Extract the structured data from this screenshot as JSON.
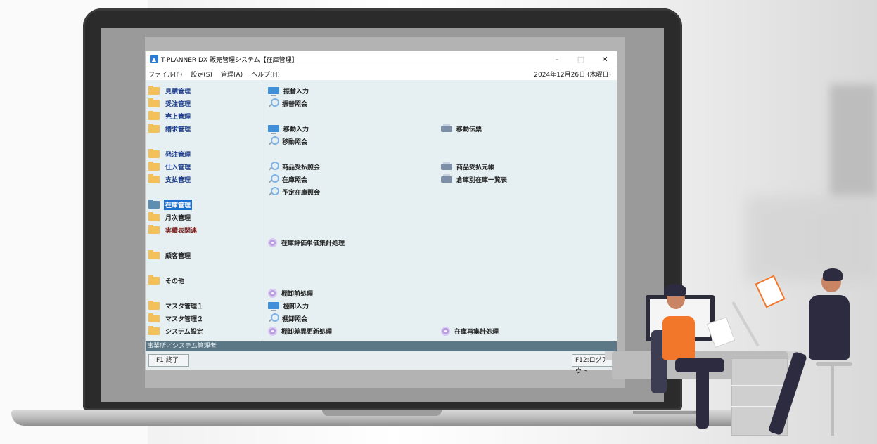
{
  "window": {
    "title": "T-PLANNER DX 販売管理システム【在庫管理】",
    "minimize": "–",
    "maximize": "□",
    "close": "✕"
  },
  "menu": {
    "items": [
      "ファイル(F)",
      "設定(S)",
      "管理(A)",
      "ヘルプ(H)"
    ],
    "date": "2024年12月26日 (木曜日)"
  },
  "sidebar": {
    "items": [
      {
        "label": "見積管理"
      },
      {
        "label": "受注管理"
      },
      {
        "label": "売上管理"
      },
      {
        "label": "請求管理"
      },
      {
        "label": "発注管理"
      },
      {
        "label": "仕入管理"
      },
      {
        "label": "支払管理"
      },
      {
        "label": "在庫管理",
        "selected": true
      },
      {
        "label": "月次管理"
      },
      {
        "label": "実績表関連"
      },
      {
        "label": "顧客管理"
      },
      {
        "label": "その他"
      },
      {
        "label": "マスタ管理１"
      },
      {
        "label": "マスタ管理２"
      },
      {
        "label": "システム設定"
      }
    ]
  },
  "functions": {
    "col1": [
      {
        "label": "振替入力",
        "icon": "monitor-icon"
      },
      {
        "label": "振替照会",
        "icon": "search-icon"
      },
      {
        "label": "移動入力",
        "icon": "monitor-icon"
      },
      {
        "label": "移動照会",
        "icon": "search-icon"
      },
      {
        "label": "商品受払照会",
        "icon": "search-icon"
      },
      {
        "label": "在庫照会",
        "icon": "search-icon"
      },
      {
        "label": "予定在庫照会",
        "icon": "search-icon"
      },
      {
        "label": "在庫評価単価集計処理",
        "icon": "gear-icon"
      },
      {
        "label": "棚卸前処理",
        "icon": "gear-icon"
      },
      {
        "label": "棚卸入力",
        "icon": "monitor-icon"
      },
      {
        "label": "棚卸照会",
        "icon": "search-icon"
      },
      {
        "label": "棚卸差異更新処理",
        "icon": "gear-icon"
      }
    ],
    "col2": [
      {
        "label": "移動伝票",
        "icon": "printer-icon"
      },
      {
        "label": "商品受払元帳",
        "icon": "printer-icon"
      },
      {
        "label": "倉庫別在庫一覧表",
        "icon": "printer-icon"
      },
      {
        "label": "在庫再集計処理",
        "icon": "gear-icon"
      }
    ]
  },
  "status": {
    "text": "事業所／システム管理者"
  },
  "fkeys": {
    "f1": "F1:終了",
    "f12": "F12:ログアウト"
  },
  "colors": {
    "accent": "#1c6fd1",
    "statusbar": "#5c7785",
    "folder": "#f3c15a",
    "orange": "#f2772a"
  }
}
